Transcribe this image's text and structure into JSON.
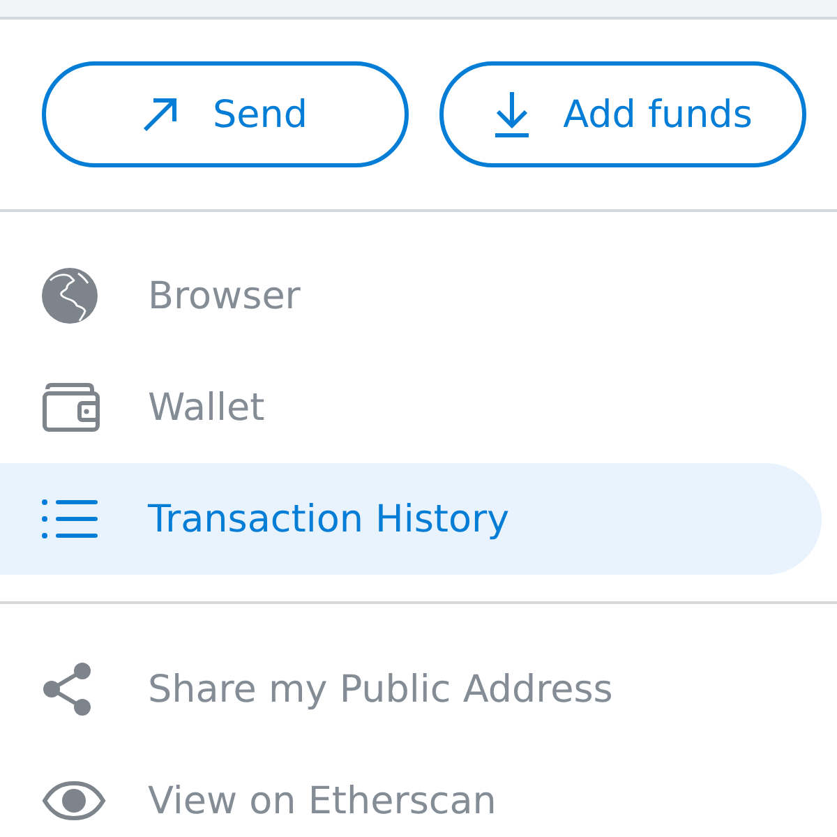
{
  "actions": [
    {
      "label": "Send"
    },
    {
      "label": "Add funds"
    }
  ],
  "menu_sections": [
    {
      "items": [
        {
          "label": "Browser",
          "selected": false
        },
        {
          "label": "Wallet",
          "selected": false
        },
        {
          "label": "Transaction History",
          "selected": true
        }
      ]
    },
    {
      "items": [
        {
          "label": "Share my Public Address",
          "selected": false
        },
        {
          "label": "View on Etherscan",
          "selected": false
        }
      ]
    }
  ]
}
